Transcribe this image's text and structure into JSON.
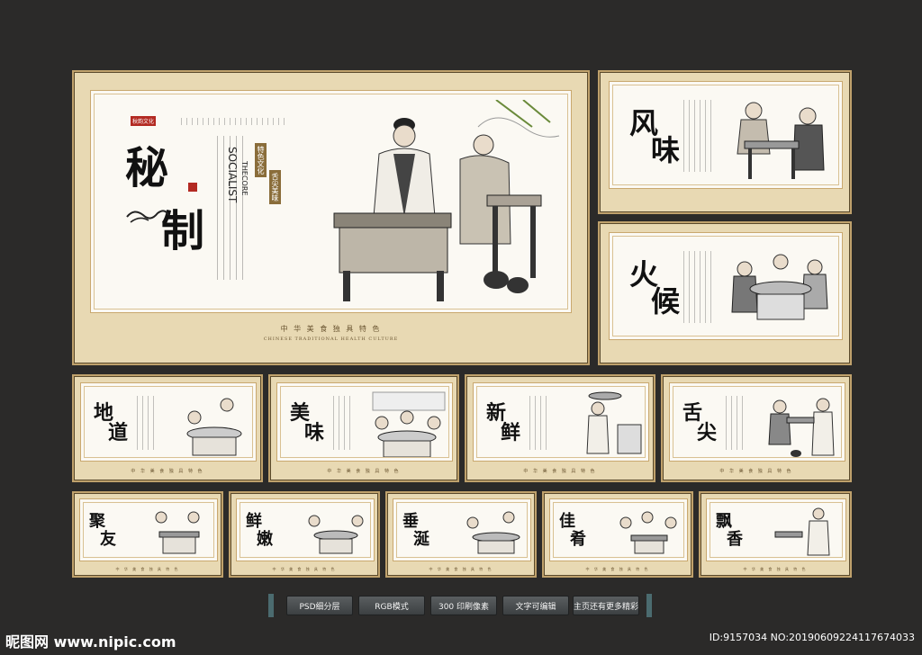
{
  "main_panel": {
    "title_chars": [
      "秘",
      "制"
    ],
    "subtitle_en_1": "SOCIALIST",
    "subtitle_en_2": "THECORE",
    "badge_1": "秋韵文化",
    "badge_2": "特色文化",
    "badge_3": "舌尖美味",
    "footer_text": "中 华 美 食 独 具 特 色",
    "footer_en": "CHINESE TRADITIONAL HEALTH CULTURE"
  },
  "side_panels": [
    {
      "chars": [
        "风",
        "味"
      ]
    },
    {
      "chars": [
        "火",
        "候"
      ]
    }
  ],
  "row_panels": [
    {
      "chars": [
        "地",
        "道"
      ]
    },
    {
      "chars": [
        "美",
        "味"
      ]
    },
    {
      "chars": [
        "新",
        "鲜"
      ]
    },
    {
      "chars": [
        "舌",
        "尖"
      ]
    }
  ],
  "bottom_panels": [
    {
      "chars": [
        "聚",
        "友"
      ]
    },
    {
      "chars": [
        "鲜",
        "嫩"
      ]
    },
    {
      "chars": [
        "垂",
        "涎"
      ]
    },
    {
      "chars": [
        "佳",
        "肴"
      ]
    },
    {
      "chars": [
        "飘",
        "香"
      ]
    }
  ],
  "small_footer": "中 华 美 食 独 具 特 色",
  "buttons": [
    "PSD细分层",
    "RGB模式",
    "300 印刷像素",
    "文字可编辑",
    "主页还有更多精彩"
  ],
  "watermark": {
    "left": "昵图网 www.nipic.com",
    "right": "ID:9157034 NO:20190609224117674033"
  },
  "colors": {
    "background": "#2b2a29",
    "frame": "#e8d9b3",
    "paper": "#fbf9f3",
    "stamp_red": "#b32a22",
    "button": "#4a4e50"
  }
}
